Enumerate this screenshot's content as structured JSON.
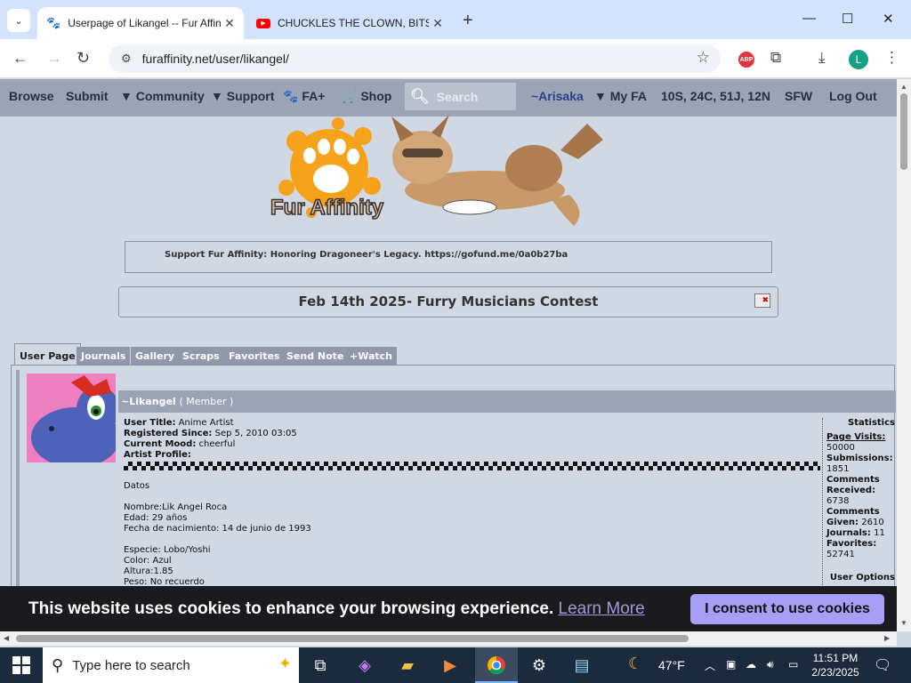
{
  "browser": {
    "tabs": [
      {
        "title": "Userpage of Likangel -- Fur Affinity",
        "active": true
      },
      {
        "title": "CHUCKLES THE CLOWN, BITSY,",
        "active": false
      }
    ],
    "url": "furaffinity.net/user/likangel/",
    "profile_initial": "L",
    "abp_label": "ABP"
  },
  "fa_nav": {
    "browse": "Browse",
    "submit": "Submit",
    "community": "▼ Community",
    "support": "▼ Support",
    "faplus": "FA+",
    "shop": "Shop",
    "search_placeholder": "Search",
    "user": "~Arisaka",
    "myfa": "▼ My FA",
    "notifications": "10S, 24C, 51J, 12N",
    "sfw": "SFW",
    "logout": "Log Out"
  },
  "banner": {
    "logo_text": "Fur Affinity"
  },
  "notice": "Support Fur Affinity: Honoring Dragoneer's Legacy. https://gofund.me/0a0b27ba",
  "contest": "Feb 14th 2025- Furry Musicians Contest",
  "profile_tabs": [
    "User Page",
    "Journals",
    "Gallery",
    "Scraps",
    "Favorites",
    "Send Note",
    "+Watch"
  ],
  "profile": {
    "name": "~Likangel",
    "member": "( Member )",
    "user_title_label": "User Title:",
    "user_title": "Anime Artist",
    "registered_label": "Registered Since:",
    "registered": "Sep 5, 2010 03:05",
    "mood_label": "Current Mood:",
    "mood": "cheerful",
    "artist_profile_label": "Artist Profile:",
    "bio": [
      "Datos",
      "",
      "Nombre:Lik Angel Roca",
      "Edad: 29 años",
      "Fecha de nacimiento: 14 de junio de 1993",
      "",
      "Especie: Lobo/Yoshi",
      "Color: Azul",
      "Altura:1.85",
      "Peso: No recuerdo"
    ]
  },
  "stats": {
    "heading": "Statistics",
    "page_visits_label": "Page Visits:",
    "page_visits": "50000",
    "submissions_label": "Submissions:",
    "submissions": "1851",
    "comments_received_label": "Comments Received:",
    "comments_received": "6738",
    "comments_given_label": "Comments Given:",
    "comments_given": "2610",
    "journals_label": "Journals:",
    "journals": "11",
    "favorites_label": "Favorites:",
    "favorites": "52741",
    "user_options": "User Options"
  },
  "cookie": {
    "message": "This website uses cookies to enhance your browsing experience.",
    "learn_more": "Learn More",
    "consent": "I consent to use cookies"
  },
  "taskbar": {
    "search_placeholder": "Type here to search",
    "weather": "47°F",
    "time": "11:51 PM",
    "date": "2/23/2025"
  }
}
